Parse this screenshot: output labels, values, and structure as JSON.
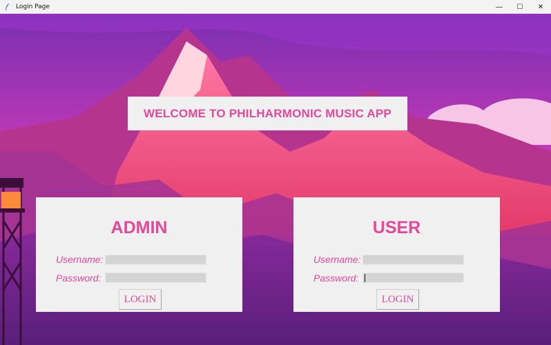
{
  "window": {
    "title": "Login Page",
    "controls": {
      "minimize": "—",
      "maximize": "☐",
      "close": "✕"
    }
  },
  "banner": {
    "text": "WELCOME TO PHILHARMONIC MUSIC APP"
  },
  "admin": {
    "heading": "ADMIN",
    "username_label": "Username:",
    "password_label": "Password:",
    "username_value": "",
    "password_value": "",
    "login_label": "LOGIN"
  },
  "user": {
    "heading": "USER",
    "username_label": "Username:",
    "password_label": "Password:",
    "username_value": "",
    "password_value": "",
    "login_label": "LOGIN"
  },
  "colors": {
    "accent": "#e4489a",
    "panel": "#f0f0f0",
    "field": "#d4d4d4"
  }
}
